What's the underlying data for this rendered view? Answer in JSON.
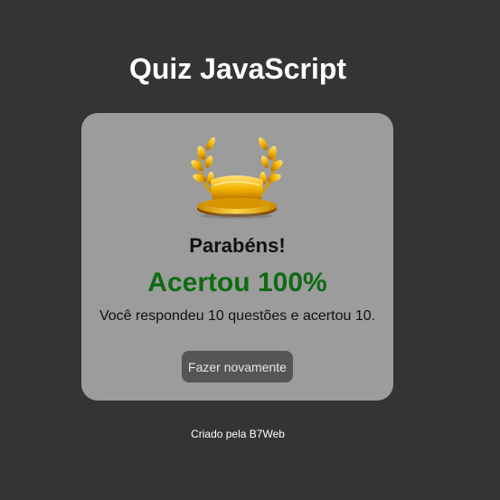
{
  "header": {
    "title": "Quiz JavaScript"
  },
  "result": {
    "icon": "trophy-laurel-icon",
    "congrats": "Parabéns!",
    "score": "Acertou 100%",
    "summary": "Você respondeu 10 questões e acertou 10.",
    "retry_label": "Fazer novamente"
  },
  "footer": {
    "credit": "Criado pela B7Web"
  },
  "colors": {
    "background": "#343434",
    "card": "#9c9c9c",
    "score_green": "#0e6b12",
    "button": "#555555"
  }
}
